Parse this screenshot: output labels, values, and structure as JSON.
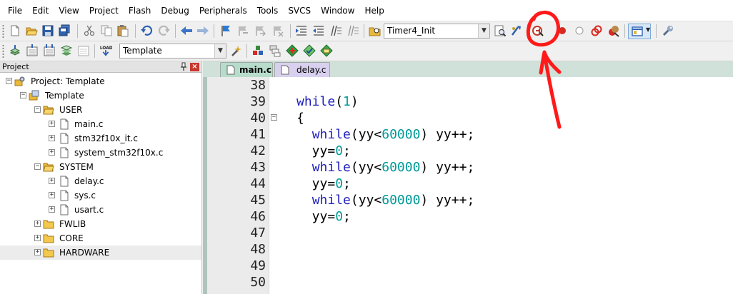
{
  "menu": [
    "File",
    "Edit",
    "View",
    "Project",
    "Flash",
    "Debug",
    "Peripherals",
    "Tools",
    "SVCS",
    "Window",
    "Help"
  ],
  "toolbar1": {
    "function_combo": "Timer4_Init",
    "icons": [
      "new-file",
      "open-file",
      "save",
      "save-all",
      "cut",
      "copy",
      "paste",
      "undo",
      "redo",
      "navigate-back",
      "navigate-forward",
      "bookmark-set",
      "bookmark-prev",
      "bookmark-next",
      "bookmark-clear",
      "indent",
      "unindent",
      "comment",
      "uncomment",
      "find-in-files",
      "find",
      "incremental-find",
      "start-debug-session",
      "insert-breakpoint",
      "enable-breakpoint",
      "disable-all-breakpoints",
      "kill-all-breakpoints",
      "window-layout",
      "configure"
    ]
  },
  "toolbar2": {
    "target_combo": "Template",
    "icons": [
      "translate",
      "build",
      "rebuild",
      "batch-build",
      "stop-build",
      "download",
      "target-options",
      "manage-components",
      "select-packs",
      "pack-installer",
      "rte-manage",
      "event-recorder"
    ]
  },
  "project_panel": {
    "title": "Project",
    "tree": [
      {
        "label": "Project: Template",
        "level": 0,
        "kind": "project",
        "expander": "−"
      },
      {
        "label": "Template",
        "level": 1,
        "kind": "target",
        "expander": "−"
      },
      {
        "label": "USER",
        "level": 2,
        "kind": "folder-open",
        "expander": "−"
      },
      {
        "label": "main.c",
        "level": 3,
        "kind": "file",
        "expander": "+"
      },
      {
        "label": "stm32f10x_it.c",
        "level": 3,
        "kind": "file",
        "expander": "+"
      },
      {
        "label": "system_stm32f10x.c",
        "level": 3,
        "kind": "file",
        "expander": "+"
      },
      {
        "label": "SYSTEM",
        "level": 2,
        "kind": "folder-open",
        "expander": "−"
      },
      {
        "label": "delay.c",
        "level": 3,
        "kind": "file",
        "expander": "+"
      },
      {
        "label": "sys.c",
        "level": 3,
        "kind": "file",
        "expander": "+"
      },
      {
        "label": "usart.c",
        "level": 3,
        "kind": "file",
        "expander": "+"
      },
      {
        "label": "FWLIB",
        "level": 2,
        "kind": "folder",
        "expander": "+"
      },
      {
        "label": "CORE",
        "level": 2,
        "kind": "folder",
        "expander": "+"
      },
      {
        "label": "HARDWARE",
        "level": 2,
        "kind": "folder",
        "expander": "+"
      }
    ]
  },
  "tabs": [
    {
      "label": "main.c",
      "active": true
    },
    {
      "label": "delay.c",
      "active": false
    }
  ],
  "editor": {
    "lines": [
      {
        "n": "38",
        "tokens": []
      },
      {
        "n": "39",
        "tokens": [
          {
            "t": "while",
            "c": "kw"
          },
          {
            "t": "(",
            "c": ""
          },
          {
            "t": "1",
            "c": "num"
          },
          {
            "t": ")",
            "c": ""
          }
        ]
      },
      {
        "n": "40",
        "tokens": [
          {
            "t": "{",
            "c": ""
          }
        ],
        "fold": "−"
      },
      {
        "n": "41",
        "tokens": [
          {
            "t": "  ",
            "c": ""
          },
          {
            "t": "while",
            "c": "kw"
          },
          {
            "t": "(yy<",
            "c": ""
          },
          {
            "t": "60000",
            "c": "num"
          },
          {
            "t": ") yy++;",
            "c": ""
          }
        ]
      },
      {
        "n": "42",
        "tokens": [
          {
            "t": "  yy=",
            "c": ""
          },
          {
            "t": "0",
            "c": "num"
          },
          {
            "t": ";",
            "c": ""
          }
        ]
      },
      {
        "n": "43",
        "tokens": [
          {
            "t": "  ",
            "c": ""
          },
          {
            "t": "while",
            "c": "kw"
          },
          {
            "t": "(yy<",
            "c": ""
          },
          {
            "t": "60000",
            "c": "num"
          },
          {
            "t": ") yy++;",
            "c": ""
          }
        ]
      },
      {
        "n": "44",
        "tokens": [
          {
            "t": "  yy=",
            "c": ""
          },
          {
            "t": "0",
            "c": "num"
          },
          {
            "t": ";",
            "c": ""
          }
        ]
      },
      {
        "n": "45",
        "tokens": [
          {
            "t": "  ",
            "c": ""
          },
          {
            "t": "while",
            "c": "kw"
          },
          {
            "t": "(yy<",
            "c": ""
          },
          {
            "t": "60000",
            "c": "num"
          },
          {
            "t": ") yy++;",
            "c": ""
          }
        ]
      },
      {
        "n": "46",
        "tokens": [
          {
            "t": "  yy=",
            "c": ""
          },
          {
            "t": "0",
            "c": "num"
          },
          {
            "t": ";",
            "c": ""
          }
        ]
      },
      {
        "n": "47",
        "tokens": []
      },
      {
        "n": "48",
        "tokens": []
      },
      {
        "n": "49",
        "tokens": []
      },
      {
        "n": "50",
        "tokens": []
      }
    ]
  },
  "colors": {
    "keyword": "#1f1fbf",
    "number": "#009999",
    "annotation": "#ff1a1a"
  }
}
